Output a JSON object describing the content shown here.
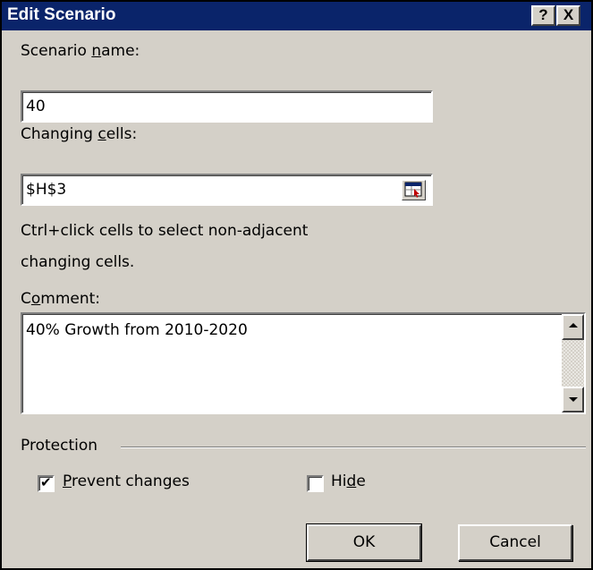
{
  "window": {
    "title": "Edit Scenario",
    "help_label": "?",
    "close_label": "X"
  },
  "scenario_name": {
    "label_pre": "Scenario ",
    "label_access": "n",
    "label_post": "ame:",
    "value": "40"
  },
  "changing_cells": {
    "label_pre": "Changing ",
    "label_access": "c",
    "label_post": "ells:",
    "value": "$H$3",
    "ref_icon": "range-select-icon"
  },
  "hint": {
    "line1": "Ctrl+click cells to select non-adjacent",
    "line2": "changing cells."
  },
  "comment": {
    "label_pre": "C",
    "label_access": "o",
    "label_post": "mment:",
    "value": "40% Growth from 2010-2020"
  },
  "protection": {
    "group_label": "Protection",
    "prevent_changes": {
      "label_access": "P",
      "label_post": "revent changes",
      "checked": true
    },
    "hide": {
      "label_pre": "Hi",
      "label_access": "d",
      "label_post": "e",
      "checked": false
    }
  },
  "buttons": {
    "ok": "OK",
    "cancel": "Cancel"
  },
  "colors": {
    "titlebar": "#0a246a",
    "face": "#d4d0c8"
  }
}
